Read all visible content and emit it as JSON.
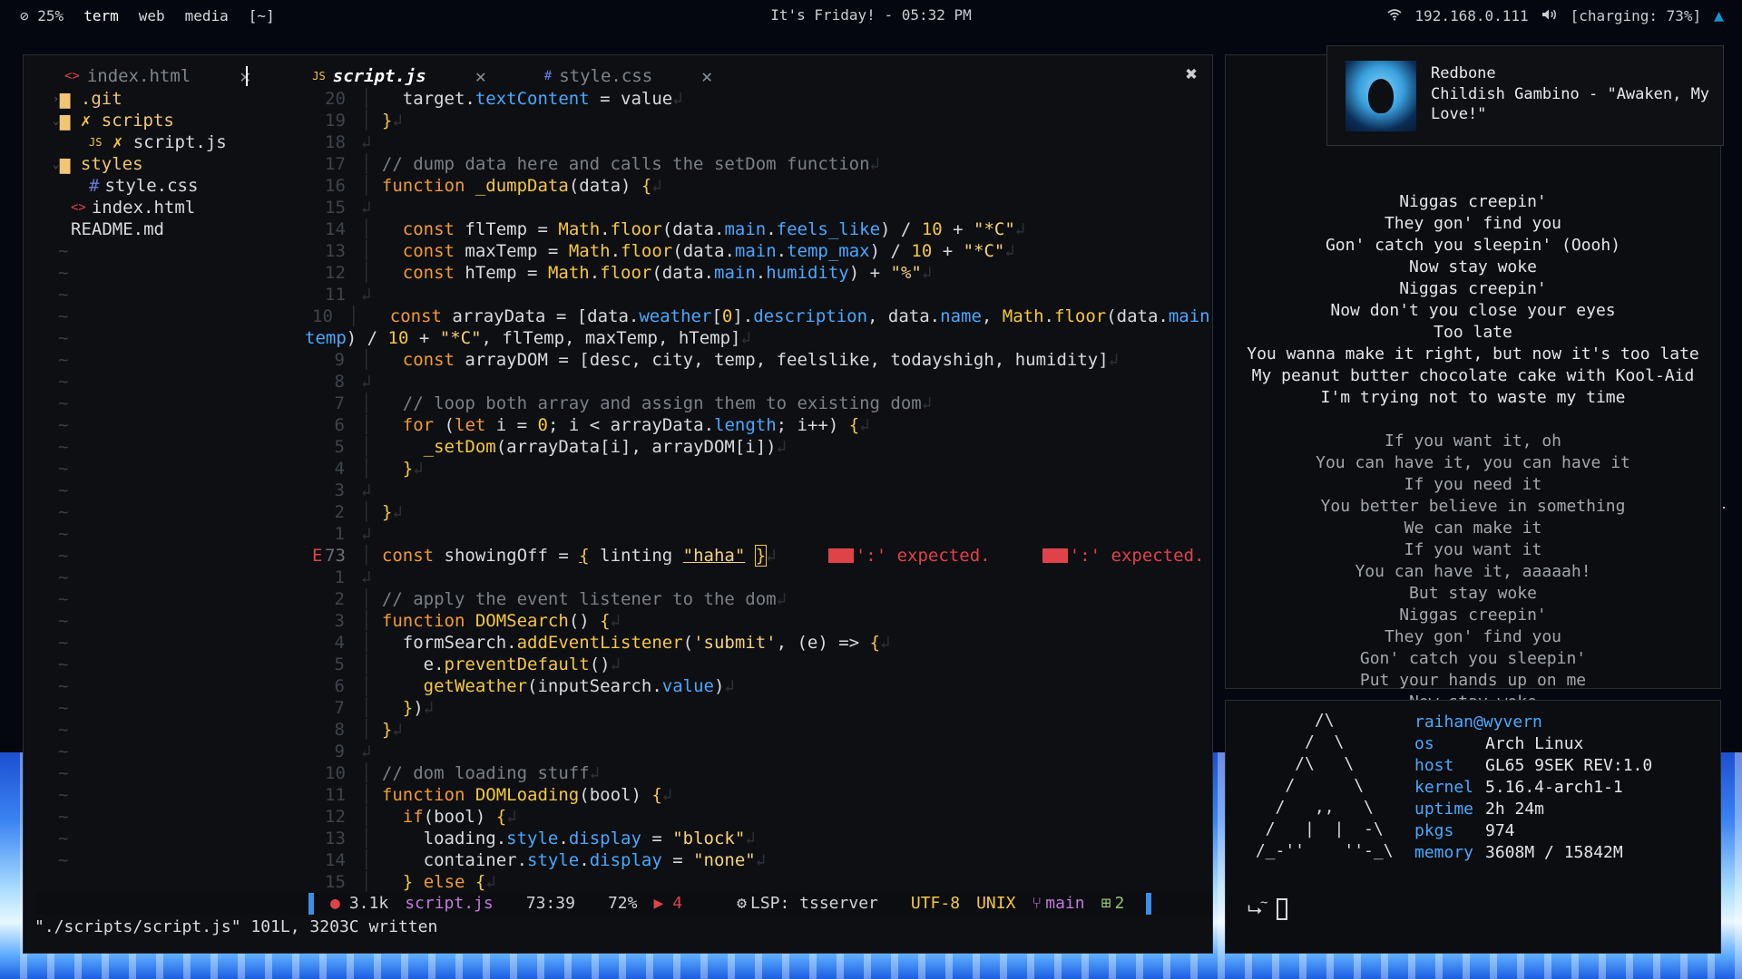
{
  "topbar": {
    "battery_percent": "25%",
    "workspaces": [
      "term",
      "web",
      "media",
      "[~]"
    ],
    "active_workspace": "term",
    "center_text": "It's Friday! - 05:32 PM",
    "ip": "192.168.0.111",
    "charging": "[charging: 73%]"
  },
  "nvim": {
    "tabs": [
      {
        "icon": "<>",
        "name": "index.html"
      },
      {
        "icon": "JS",
        "name": "script.js"
      },
      {
        "icon": "#",
        "name": "style.css"
      }
    ],
    "active_tab": "script.js",
    "tree": [
      {
        "type": "folder",
        "name": ".git",
        "arrow": "›"
      },
      {
        "type": "folder",
        "name": "scripts",
        "arrow": "⌄"
      },
      {
        "type": "file",
        "icon": "JS",
        "name": "script.js"
      },
      {
        "type": "folder",
        "name": "styles",
        "arrow": "⌄"
      },
      {
        "type": "file",
        "icon": "#",
        "name": "style.css"
      },
      {
        "type": "file",
        "icon": "<>",
        "name": "index.html"
      },
      {
        "type": "file",
        "icon": "",
        "name": "README.md"
      }
    ],
    "statusline": {
      "size": "3.1k",
      "file": "script.js",
      "position": "73:39",
      "percent": "72%",
      "errors": "4",
      "lsp": "LSP: tsserver",
      "encoding": "UTF-8",
      "format": "UNIX",
      "branch": "main",
      "changes": "2"
    },
    "cmdline": "\"./scripts/script.js\" 101L, 3203C written",
    "colors": {
      "error": "#e0424a",
      "keyword": "#f29a38",
      "function": "#f6c744",
      "property": "#4aa8ff",
      "accent": "#3a8ee6"
    }
  },
  "player": {
    "title": "Redbone",
    "artist_album": "Childish Gambino - \"Awaken, My Love!\""
  },
  "lyrics": [
    "Niggas creepin'",
    "They gon' find you",
    "Gon' catch you sleepin' (Oooh)",
    "Now stay woke",
    "Niggas creepin'",
    "Now don't you close your eyes",
    "Too late",
    "You wanna make it right, but now it's too late",
    "My peanut butter chocolate cake with Kool-Aid",
    "I'm trying not to waste my time",
    "",
    "If you want it, oh",
    "You can have it, you can have it",
    "If you need it",
    "You better believe in something",
    "We can make it",
    "If you want it",
    "You can have it, aaaaah!",
    "But stay woke",
    "Niggas creepin'",
    "They gon' find you",
    "Gon' catch you sleepin'",
    "Put your hands up on me",
    "Now stay woke"
  ],
  "fetch": {
    "user": "raihan@wyvern",
    "rows": [
      {
        "key": "os",
        "value": "Arch Linux"
      },
      {
        "key": "host",
        "value": "GL65 9SEK REV:1.0"
      },
      {
        "key": "kernel",
        "value": "5.16.4-arch1-1"
      },
      {
        "key": "uptime",
        "value": "2h 24m"
      },
      {
        "key": "pkgs",
        "value": "974"
      },
      {
        "key": "memory",
        "value": "3608M / 15842M"
      }
    ],
    "prompt_dir": "~"
  }
}
